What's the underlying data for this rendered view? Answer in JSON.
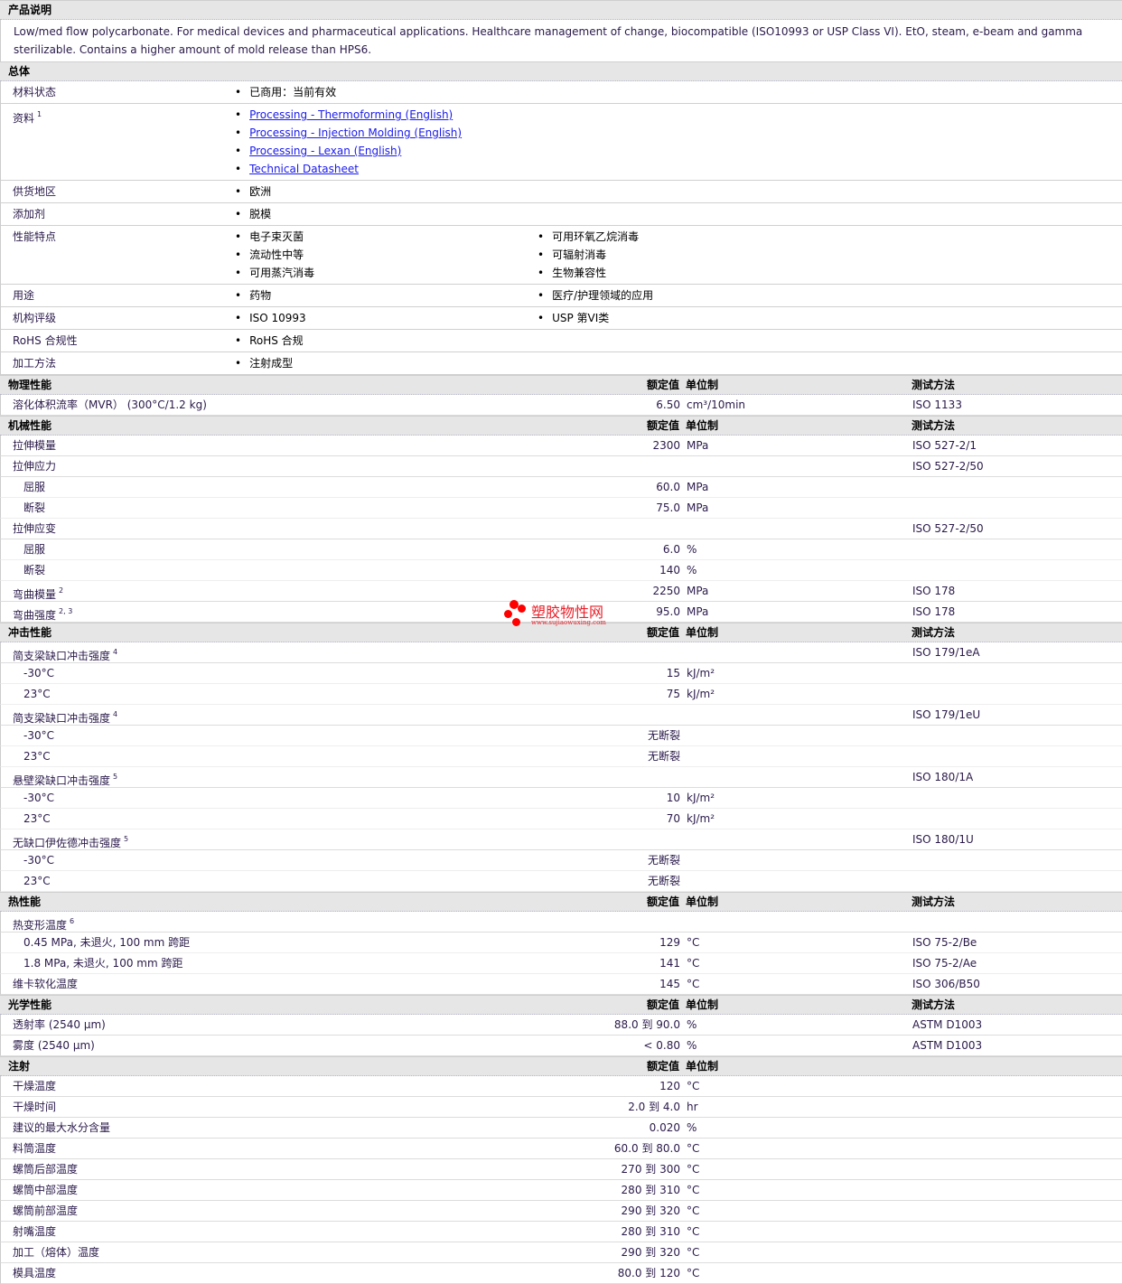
{
  "product_description": {
    "title": "产品说明",
    "text": "Low/med flow polycarbonate. For medical devices and pharmaceutical applications. Healthcare management of change, biocompatible (ISO10993 or USP Class VI). EtO, steam, e-beam and gamma sterilizable. Contains a higher amount of mold release than HPS6."
  },
  "general": {
    "title": "总体",
    "rows": [
      {
        "label": "材料状态",
        "items": [
          "已商用：当前有效"
        ]
      },
      {
        "label": "资料",
        "sup": "1",
        "links": [
          "Processing - Thermoforming (English)",
          "Processing - Injection Molding (English)",
          "Processing - Lexan (English)",
          "Technical Datasheet"
        ]
      },
      {
        "label": "供货地区",
        "items": [
          "欧洲"
        ]
      },
      {
        "label": "添加剂",
        "items": [
          "脱模"
        ]
      },
      {
        "label": "性能特点",
        "items": [
          "电子束灭菌",
          "可用环氧乙烷消毒",
          "流动性中等",
          "可辐射消毒",
          "可用蒸汽消毒",
          "生物兼容性"
        ]
      },
      {
        "label": "用途",
        "items": [
          "药物",
          "医疗/护理领域的应用"
        ]
      },
      {
        "label": "机构评级",
        "items": [
          "ISO 10993",
          "USP 第VI类"
        ]
      },
      {
        "label": "RoHS 合规性",
        "items": [
          "RoHS 合规"
        ]
      },
      {
        "label": "加工方法",
        "items": [
          "注射成型"
        ]
      }
    ]
  },
  "headers": {
    "value": "额定值",
    "unit": "单位制",
    "method": "测试方法"
  },
  "sections": [
    {
      "title": "物理性能",
      "method_header": true,
      "rows": [
        {
          "label": "溶化体积流率（MVR） (300°C/1.2 kg)",
          "value": "6.50",
          "unit": "cm³/10min",
          "method": "ISO 1133"
        }
      ]
    },
    {
      "title": "机械性能",
      "method_header": true,
      "rows": [
        {
          "label": "拉伸模量",
          "value": "2300",
          "unit": "MPa",
          "method": "ISO 527-2/1"
        },
        {
          "label": "拉伸应力",
          "method": "ISO 527-2/50"
        },
        {
          "label": "屈服",
          "sub": true,
          "value": "60.0",
          "unit": "MPa"
        },
        {
          "label": "断裂",
          "sub": true,
          "value": "75.0",
          "unit": "MPa"
        },
        {
          "label": "拉伸应变",
          "method": "ISO 527-2/50"
        },
        {
          "label": "屈服",
          "sub": true,
          "value": "6.0",
          "unit": "%"
        },
        {
          "label": "断裂",
          "sub": true,
          "value": "140",
          "unit": "%"
        },
        {
          "label": "弯曲模量",
          "sup": "2",
          "value": "2250",
          "unit": "MPa",
          "method": "ISO 178"
        },
        {
          "label": "弯曲强度",
          "sup": "2, 3",
          "value": "95.0",
          "unit": "MPa",
          "method": "ISO 178"
        }
      ]
    },
    {
      "title": "冲击性能",
      "method_header": true,
      "rows": [
        {
          "label": "简支梁缺口冲击强度",
          "sup": "4",
          "method": "ISO 179/1eA"
        },
        {
          "label": "-30°C",
          "sub": true,
          "value": "15",
          "unit": "kJ/m²"
        },
        {
          "label": "23°C",
          "sub": true,
          "value": "75",
          "unit": "kJ/m²"
        },
        {
          "label": "简支梁缺口冲击强度",
          "sup": "4",
          "method": "ISO 179/1eU"
        },
        {
          "label": "-30°C",
          "sub": true,
          "value": "无断裂"
        },
        {
          "label": "23°C",
          "sub": true,
          "value": "无断裂"
        },
        {
          "label": "悬壁梁缺口冲击强度",
          "sup": "5",
          "method": "ISO 180/1A"
        },
        {
          "label": "-30°C",
          "sub": true,
          "value": "10",
          "unit": "kJ/m²"
        },
        {
          "label": "23°C",
          "sub": true,
          "value": "70",
          "unit": "kJ/m²"
        },
        {
          "label": "无缺口伊佐德冲击强度",
          "sup": "5",
          "method": "ISO 180/1U"
        },
        {
          "label": "-30°C",
          "sub": true,
          "value": "无断裂"
        },
        {
          "label": "23°C",
          "sub": true,
          "value": "无断裂"
        }
      ]
    },
    {
      "title": "热性能",
      "method_header": true,
      "rows": [
        {
          "label": "热变形温度",
          "sup": "6"
        },
        {
          "label": "0.45 MPa, 未退火, 100 mm 跨距",
          "sub": true,
          "value": "129",
          "unit": "°C",
          "method": "ISO 75-2/Be"
        },
        {
          "label": "1.8 MPa, 未退火, 100 mm 跨距",
          "sub": true,
          "value": "141",
          "unit": "°C",
          "method": "ISO 75-2/Ae"
        },
        {
          "label": "维卡软化温度",
          "value": "145",
          "unit": "°C",
          "method": "ISO 306/B50"
        }
      ]
    },
    {
      "title": "光学性能",
      "method_header": true,
      "rows": [
        {
          "label": "透射率 (2540 µm)",
          "value": "88.0 到  90.0",
          "unit": "%",
          "method": "ASTM D1003"
        },
        {
          "label": "雾度 (2540 µm)",
          "value": "< 0.80",
          "unit": "%",
          "method": "ASTM D1003"
        }
      ]
    },
    {
      "title": "注射",
      "method_header": false,
      "rows": [
        {
          "label": "干燥温度",
          "value": "120",
          "unit": "°C"
        },
        {
          "label": "干燥时间",
          "value": "2.0 到  4.0",
          "unit": "hr"
        },
        {
          "label": "建议的最大水分含量",
          "value": "0.020",
          "unit": "%"
        },
        {
          "label": "料筒温度",
          "value": "60.0 到  80.0",
          "unit": "°C"
        },
        {
          "label": "螺筒后部温度",
          "value": "270 到  300",
          "unit": "°C"
        },
        {
          "label": "螺筒中部温度",
          "value": "280 到  310",
          "unit": "°C"
        },
        {
          "label": "螺筒前部温度",
          "value": "290 到  320",
          "unit": "°C"
        },
        {
          "label": "射嘴温度",
          "value": "280 到  310",
          "unit": "°C"
        },
        {
          "label": "加工（熔体）温度",
          "value": "290 到  320",
          "unit": "°C"
        },
        {
          "label": "模具温度",
          "value": "80.0 到  120",
          "unit": "°C"
        }
      ]
    }
  ],
  "watermark": {
    "name": "塑胶物性网",
    "url": "www.sujiaowuxing.com"
  }
}
